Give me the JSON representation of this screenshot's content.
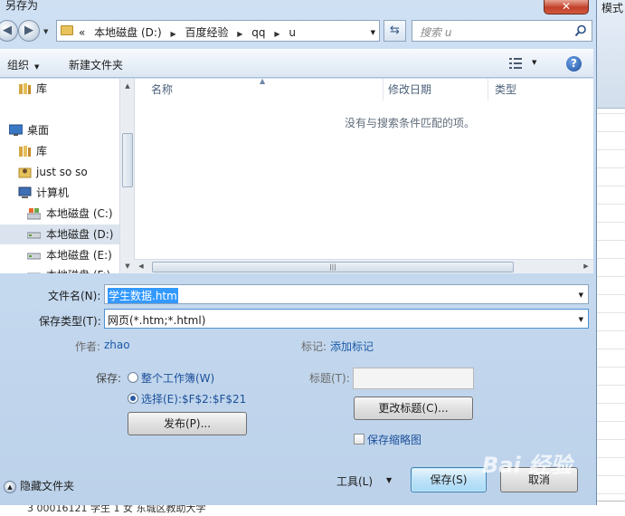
{
  "window": {
    "title": "另存为",
    "close_label": "✕"
  },
  "background_app": {
    "ribbon_tab": "模式",
    "bottom_row_text": "3 00016121 学生 1 女 东城区教助大学"
  },
  "address_bar": {
    "breadcrumbs": [
      "«",
      "本地磁盘 (D:)",
      "百度经验",
      "qq",
      "u"
    ],
    "separator": "▶"
  },
  "search": {
    "placeholder": "搜索 u"
  },
  "toolbar": {
    "organize_label": "组织",
    "new_folder_label": "新建文件夹"
  },
  "nav_pane": {
    "items": [
      {
        "label": "库",
        "icon": "library-icon",
        "indent": 0
      },
      {
        "label": "桌面",
        "icon": "desktop-icon",
        "indent": 0
      },
      {
        "label": "库",
        "icon": "library-icon",
        "indent": 1
      },
      {
        "label": "just so so",
        "icon": "user-folder-icon",
        "indent": 1
      },
      {
        "label": "计算机",
        "icon": "computer-icon",
        "indent": 1
      },
      {
        "label": "本地磁盘 (C:)",
        "icon": "system-drive-icon",
        "indent": 2
      },
      {
        "label": "本地磁盘 (D:)",
        "icon": "drive-icon",
        "indent": 2,
        "selected": true
      },
      {
        "label": "本地磁盘 (E:)",
        "icon": "drive-icon",
        "indent": 2
      },
      {
        "label": "本地磁盘 (F:)",
        "icon": "drive-icon",
        "indent": 2
      }
    ]
  },
  "file_list": {
    "columns": [
      "名称",
      "修改日期",
      "类型"
    ],
    "empty_message": "没有与搜索条件匹配的项。"
  },
  "form": {
    "filename_label": "文件名(N):",
    "filename_value": "学生数据.htm",
    "filetype_label": "保存类型(T):",
    "filetype_value": "网页(*.htm;*.html)",
    "author_label": "作者:",
    "author_value": "zhao",
    "tags_label": "标记:",
    "tags_value": "添加标记",
    "save_label": "保存:",
    "radio_workbook": "整个工作簿(W)",
    "radio_selection": "选择(E):$F$2:$F$21",
    "selected_option": "selection",
    "publish_button": "发布(P)...",
    "title_label": "标题(T):",
    "title_value": "",
    "change_title_button": "更改标题(C)...",
    "thumbnail_label": "保存缩略图",
    "thumbnail_checked": false
  },
  "footer": {
    "hide_folders": "隐藏文件夹",
    "tools_label": "工具(L)",
    "save_button": "保存(S)",
    "cancel_button": "取消"
  },
  "watermark": "Bai 经验"
}
